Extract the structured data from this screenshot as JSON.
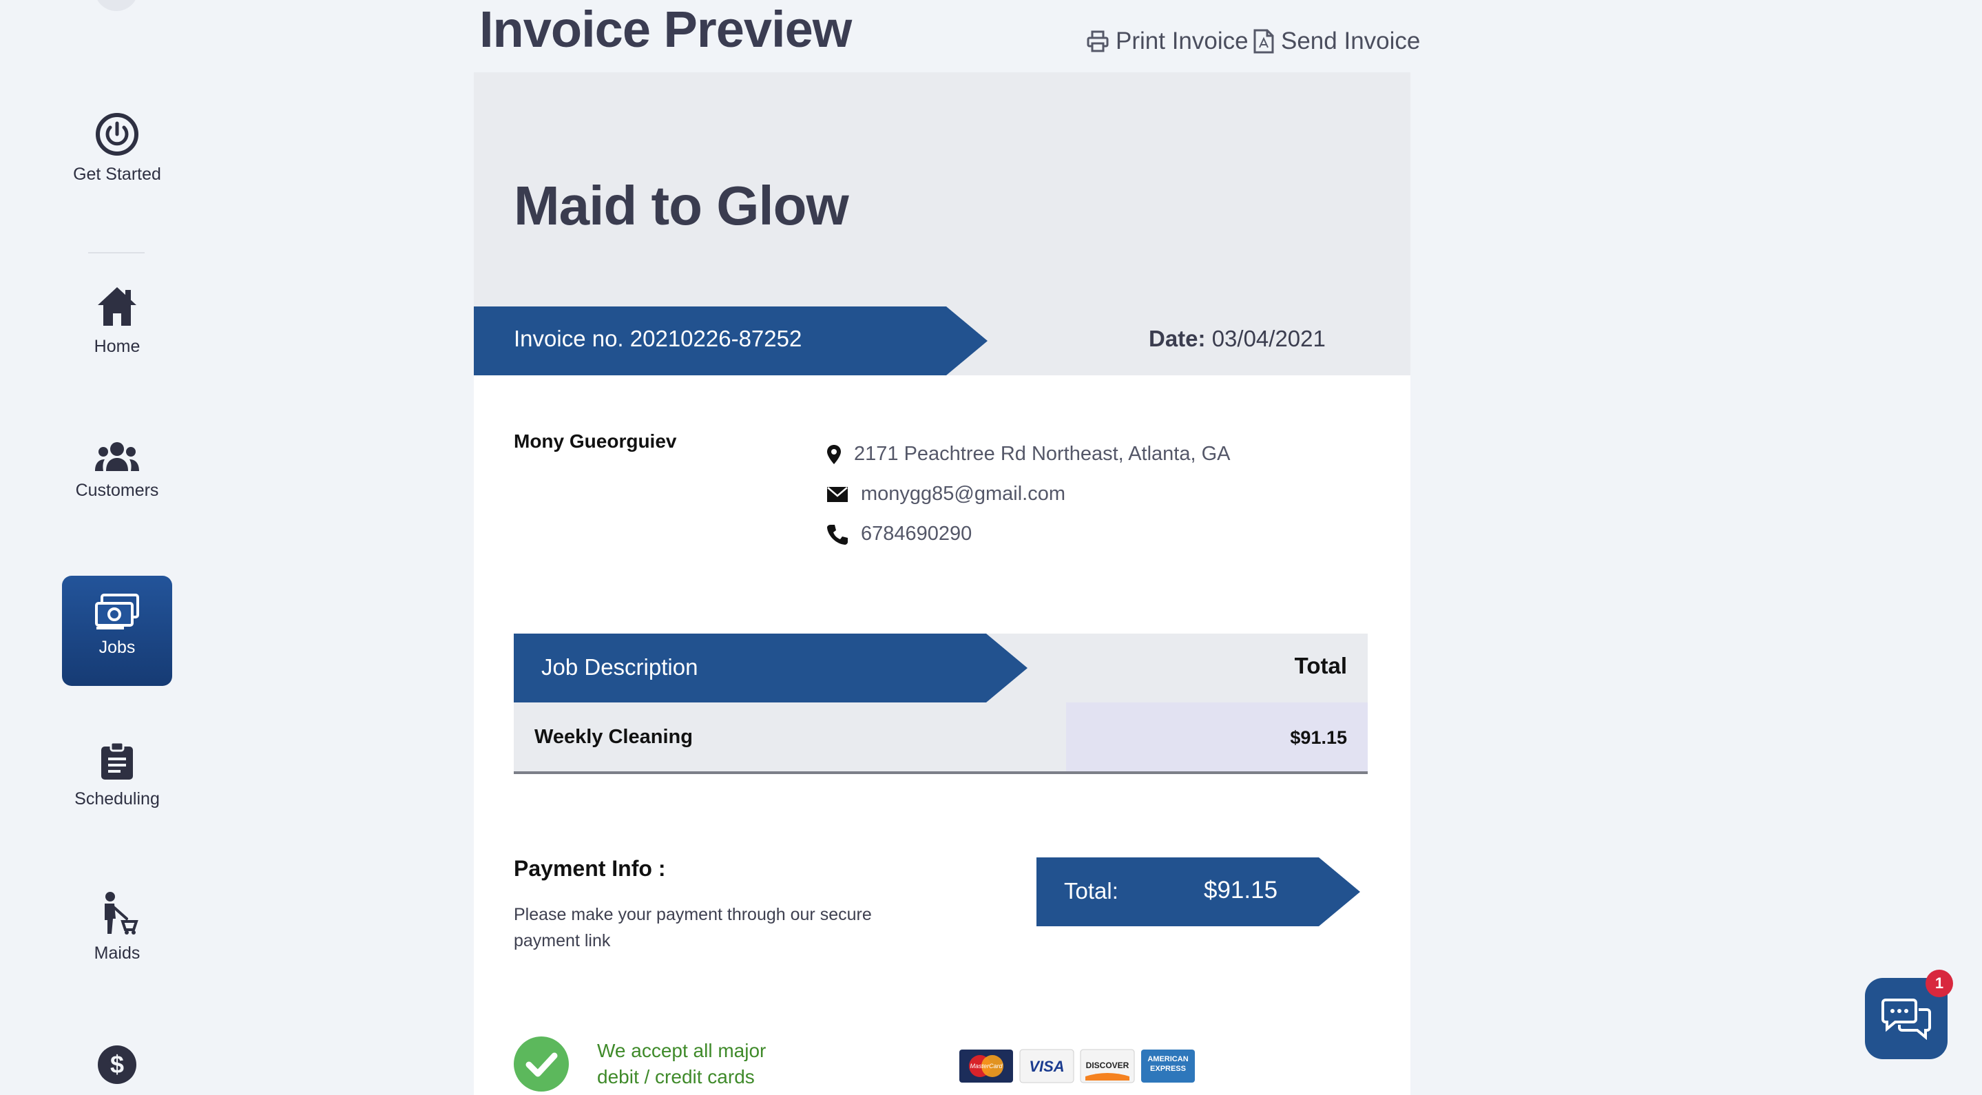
{
  "sidebar": {
    "items": [
      {
        "label": "Get Started",
        "icon": "power-icon"
      },
      {
        "label": "Home",
        "icon": "home-icon"
      },
      {
        "label": "Customers",
        "icon": "users-icon"
      },
      {
        "label": "Jobs",
        "icon": "money-icon",
        "active": true
      },
      {
        "label": "Scheduling",
        "icon": "clipboard-icon"
      },
      {
        "label": "Maids",
        "icon": "cleaner-icon"
      },
      {
        "label": "",
        "icon": "dollar-icon"
      }
    ]
  },
  "header": {
    "title": "Invoice Preview",
    "print_label": "Print Invoice",
    "send_label": "Send Invoice"
  },
  "invoice": {
    "company": "Maid to Glow",
    "number_label": "Invoice no. 20210226-87252",
    "date_label": "Date:",
    "date_value": "03/04/2021",
    "customer": {
      "name": "Mony Gueorguiev",
      "address": "2171 Peachtree Rd Northeast, Atlanta, GA",
      "email": "monygg85@gmail.com",
      "phone": "6784690290"
    },
    "table": {
      "col_description": "Job Description",
      "col_total": "Total",
      "rows": [
        {
          "description": "Weekly Cleaning",
          "total": "$91.15"
        }
      ]
    },
    "payment": {
      "title": "Payment Info :",
      "description": "Please make your payment through our secure payment link",
      "total_label": "Total:",
      "total_value": "$91.15"
    },
    "accept_line1": "We accept all major",
    "accept_line2": "debit / credit cards",
    "cards": [
      "MasterCard",
      "VISA",
      "DISCOVER",
      "AMERICAN EXPRESS"
    ]
  },
  "chat": {
    "badge_count": "1"
  },
  "colors": {
    "accent": "#22528f",
    "success": "#5cb85c",
    "badge": "#d8283e"
  }
}
